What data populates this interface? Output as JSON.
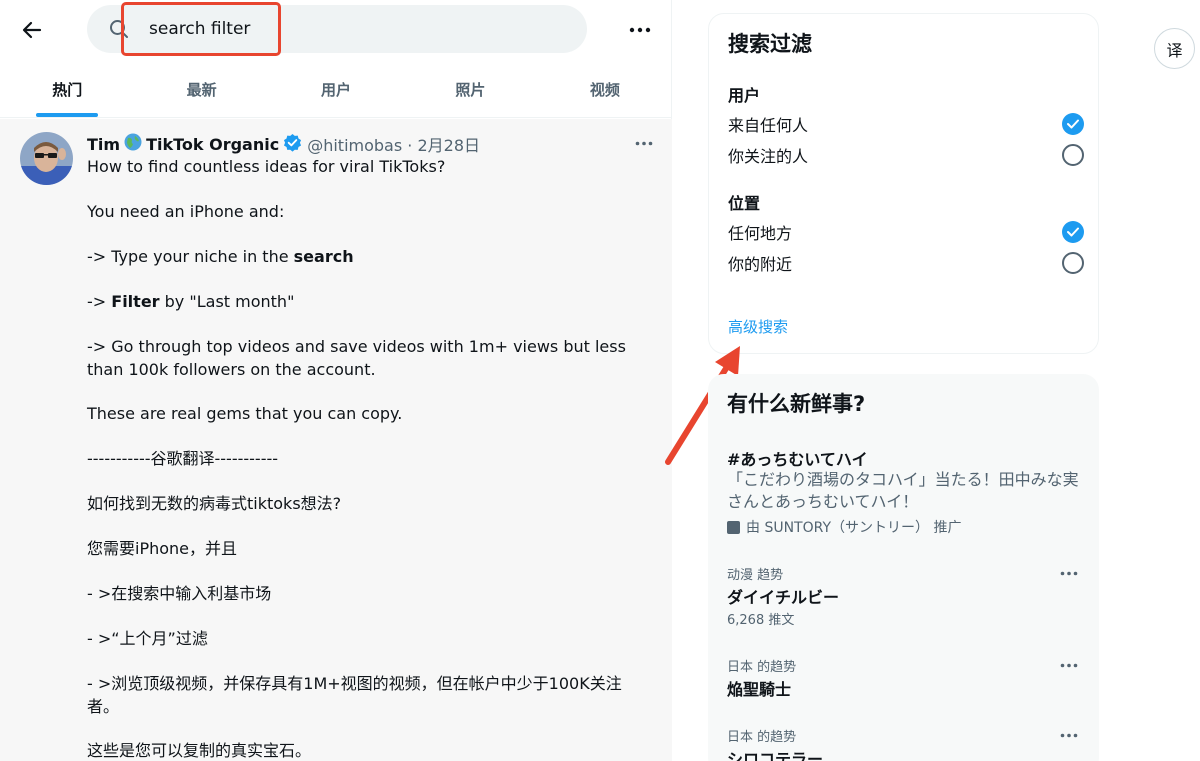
{
  "search": {
    "value": "search filter"
  },
  "tabs": [
    {
      "label": "热门",
      "active": true
    },
    {
      "label": "最新"
    },
    {
      "label": "用户"
    },
    {
      "label": "照片"
    },
    {
      "label": "视频"
    }
  ],
  "tweet": {
    "name_part1": "Tim",
    "name_part2": "TikTok Organic",
    "handle_date": "@hitimobas · 2月28日",
    "lines": [
      "How to find countless ideas for viral TikToks?",
      "You need an iPhone and:",
      {
        "before": "-> Type your niche in the ",
        "bold": "search",
        "after": ""
      },
      {
        "before": "-> ",
        "bold": "Filter",
        "after": " by \"Last month\""
      },
      "-> Go through top videos and save videos with 1m+ views but less than 100k followers on the account.",
      "These are real gems that you can copy.",
      "-----------谷歌翻译-----------",
      "如何找到无数的病毒式tiktoks想法?",
      "您需要iPhone，并且",
      " - >在搜索中输入利基市场",
      " - >“上个月”过滤",
      " - >浏览顶级视频，并保存具有1M+视图的视频，但在帐户中少于100K关注者。",
      "这些是您可以复制的真实宝石。"
    ]
  },
  "filter": {
    "title": "搜索过滤",
    "user_label": "用户",
    "user_options": [
      {
        "label": "来自任何人",
        "checked": true
      },
      {
        "label": "你关注的人",
        "checked": false
      }
    ],
    "location_label": "位置",
    "location_options": [
      {
        "label": "任何地方",
        "checked": true
      },
      {
        "label": "你的附近",
        "checked": false
      }
    ],
    "advanced_link": "高级搜索"
  },
  "trends": {
    "title": "有什么新鲜事?",
    "promo": {
      "tag": "#あっちむいてハイ",
      "desc": "「こだわり酒場のタコハイ」当たる！田中みな実さんとあっちむいてハイ！",
      "by": "由 SUNTORY（サントリー） 推广"
    },
    "items": [
      {
        "meta": "动漫 趋势",
        "name": "ダイイチルビー",
        "count": "6,268 推文"
      },
      {
        "meta": "日本 的趋势",
        "name": "焔聖騎士",
        "count": ""
      },
      {
        "meta": "日本 的趋势",
        "name": "シロコテラー",
        "count": ""
      }
    ]
  },
  "translate_button": "译",
  "colors": {
    "accent": "#1d9bf0",
    "annotation": "#e8452f"
  },
  "icons": [
    "back-arrow-icon",
    "search-icon",
    "more-icon",
    "globe-icon",
    "verified-badge-icon",
    "checkmark-icon",
    "promoted-icon"
  ]
}
